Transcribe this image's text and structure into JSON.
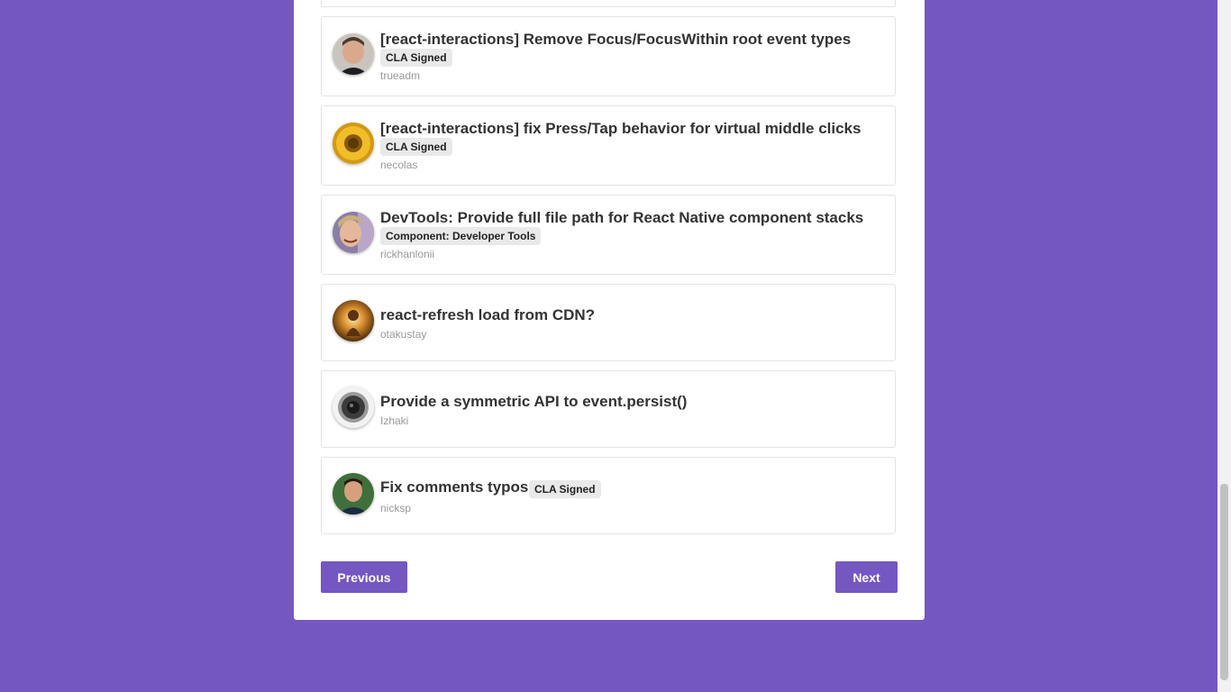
{
  "issues": [
    {
      "title": "[react-interactions] Remove Focus/FocusWithin root event types",
      "badge": "CLA Signed",
      "author": "trueadm",
      "avatar_icon": "man-portrait-avatar"
    },
    {
      "title": "[react-interactions] fix Press/Tap behavior for virtual middle clicks",
      "badge": "CLA Signed",
      "author": "necolas",
      "avatar_icon": "sunflower-avatar"
    },
    {
      "title": "DevTools: Provide full file path for React Native component stacks",
      "badge": "Component: Developer Tools",
      "author": "rickhanlonii",
      "avatar_icon": "smiling-man-avatar"
    },
    {
      "title": "react-refresh load from CDN?",
      "author": "otakustay",
      "avatar_icon": "glowing-figure-avatar"
    },
    {
      "title": "Provide a symmetric API to event.persist()",
      "author": "Izhaki",
      "avatar_icon": "speaker-avatar"
    },
    {
      "title": "Fix comments typos",
      "badge": "CLA Signed",
      "author": "nicksp",
      "avatar_icon": "man-outdoors-avatar"
    }
  ],
  "pagination": {
    "previous_label": "Previous",
    "next_label": "Next"
  },
  "colors": {
    "background": "#7457c1",
    "button": "#7457c1",
    "badge_bg": "#e9e9e9"
  }
}
